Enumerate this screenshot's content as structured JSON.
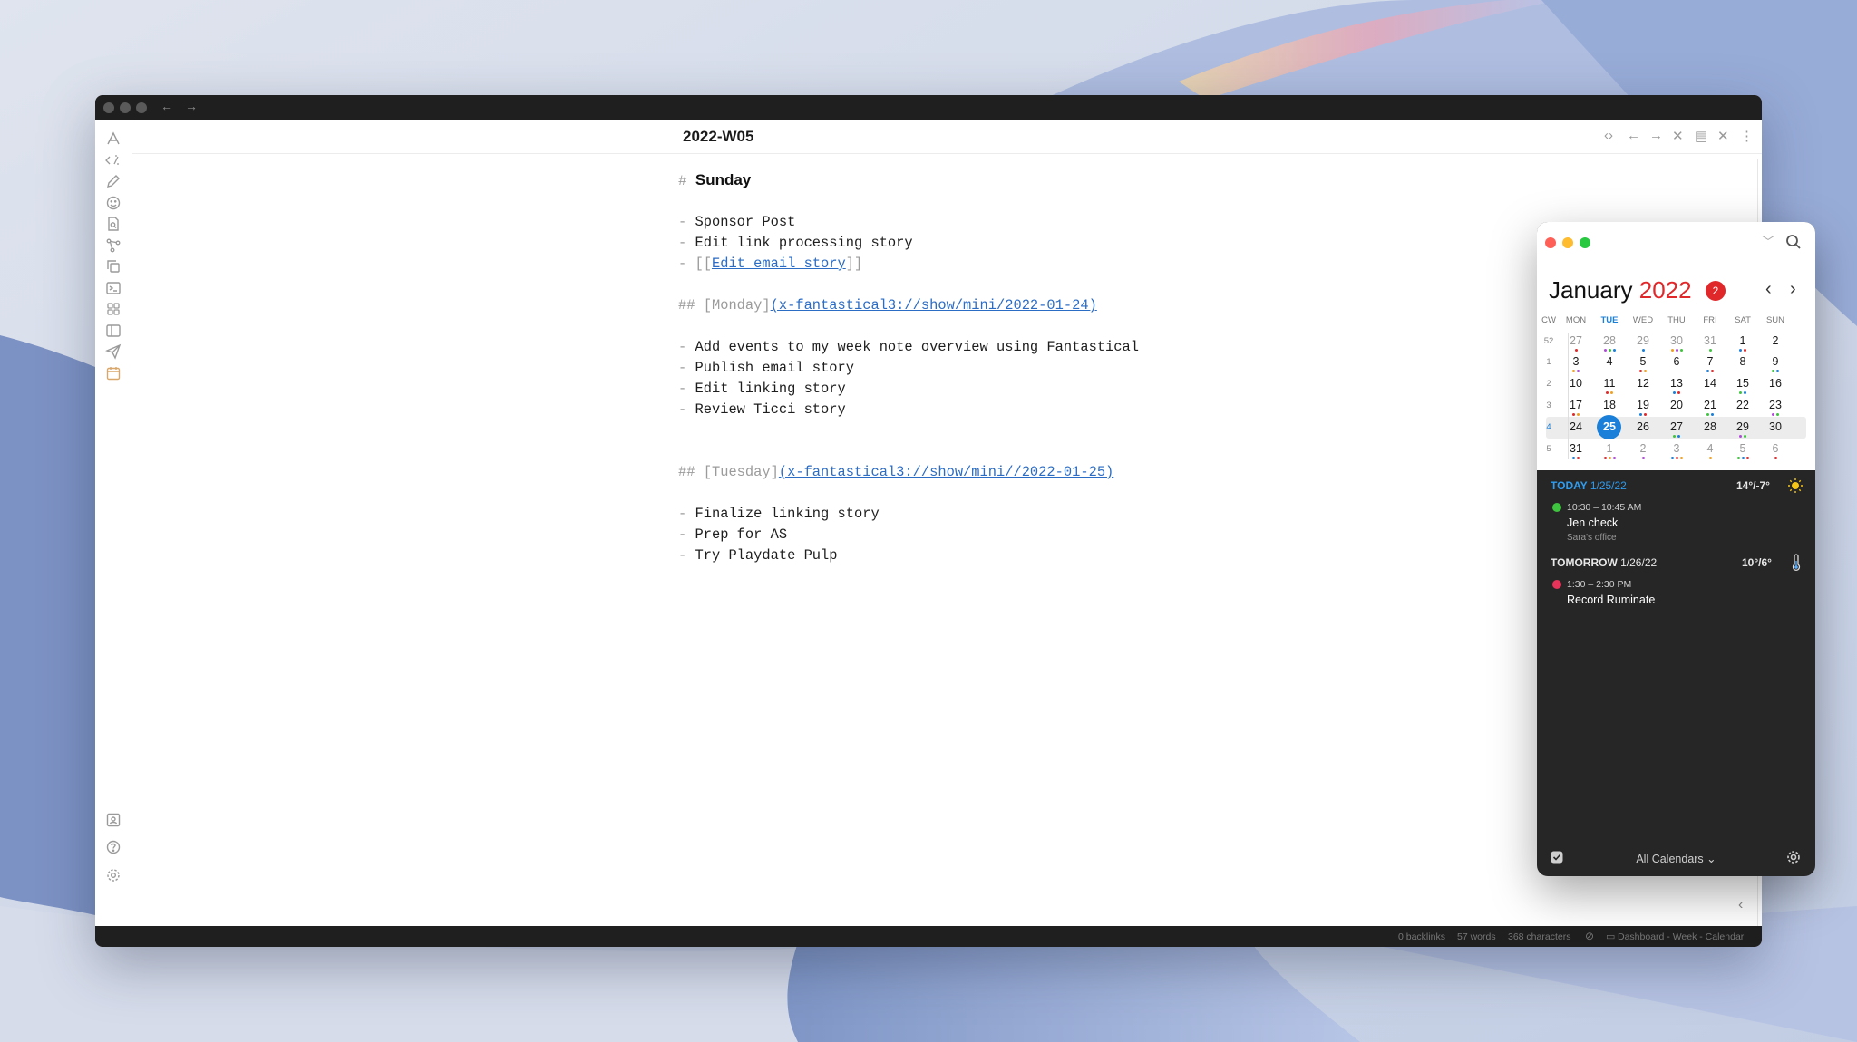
{
  "note": {
    "title": "2022-W05",
    "sunday": {
      "marker": "#",
      "heading": "Sunday",
      "items": [
        "Sponsor Post",
        "Edit link processing story"
      ],
      "link_item": {
        "open": "[[",
        "label": "Edit email story",
        "close": "]]"
      }
    },
    "monday": {
      "marker": "##",
      "bracket_label": "[Monday]",
      "url": "(x-fantastical3://show/mini/2022-01-24)",
      "items": [
        "Add events to my week note overview using Fantastical",
        "Publish email story",
        "Edit linking story",
        "Review Ticci story"
      ]
    },
    "tuesday": {
      "marker": "##",
      "bracket_label": "[Tuesday]",
      "url": "(x-fantastical3://show/mini//2022-01-25)",
      "items": [
        "Finalize linking story",
        "Prep for AS",
        "Try Playdate Pulp"
      ]
    },
    "bullet": "-"
  },
  "status_bar": {
    "backlinks": "0 backlinks",
    "words": "57 words",
    "characters": "368 characters",
    "workspace": "Dashboard - Week - Calendar"
  },
  "icons": {
    "ribbon": [
      "pdf-icon",
      "templater-icon",
      "pencil-icon",
      "emoji-icon",
      "search-file-icon",
      "graph-icon",
      "copy-icon",
      "terminal-icon",
      "grid-icon",
      "layout-icon",
      "send-icon",
      "calendar-icon"
    ],
    "ribbon_bottom": [
      "vault-icon",
      "help-icon",
      "settings-icon"
    ]
  },
  "fantastical": {
    "month": "January",
    "year": "2022",
    "badge": "2",
    "weekday_headers": [
      "CW",
      "MON",
      "TUE",
      "WED",
      "THU",
      "FRI",
      "SAT",
      "SUN"
    ],
    "weeks": [
      {
        "cw": "52",
        "days": [
          "27",
          "28",
          "29",
          "30",
          "31",
          "1",
          "2"
        ]
      },
      {
        "cw": "1",
        "days": [
          "3",
          "4",
          "5",
          "6",
          "7",
          "8",
          "9"
        ]
      },
      {
        "cw": "2",
        "days": [
          "10",
          "11",
          "12",
          "13",
          "14",
          "15",
          "16"
        ]
      },
      {
        "cw": "3",
        "days": [
          "17",
          "18",
          "19",
          "20",
          "21",
          "22",
          "23"
        ]
      },
      {
        "cw": "4",
        "days": [
          "24",
          "25",
          "26",
          "27",
          "28",
          "29",
          "30"
        ]
      },
      {
        "cw": "5",
        "days": [
          "31",
          "1",
          "2",
          "3",
          "4",
          "5",
          "6"
        ]
      }
    ],
    "today": {
      "label": "TODAY",
      "date": "1/25/22",
      "temp": "14°/-7°",
      "event": {
        "time": "10:30 – 10:45 AM",
        "title": "Jen check",
        "location": "Sara's office",
        "color": "#3ec43e"
      }
    },
    "tomorrow": {
      "label": "TOMORROW",
      "date": "1/26/22",
      "temp": "10°/6°",
      "event": {
        "time": "1:30 – 2:30 PM",
        "title": "Record Ruminate",
        "color": "#e8335a"
      }
    },
    "footer": {
      "calendars": "All Calendars ⌄"
    }
  },
  "colors": {
    "accent": "#1a7fd8",
    "link": "#2b6cc4",
    "red": "#e0282b"
  }
}
